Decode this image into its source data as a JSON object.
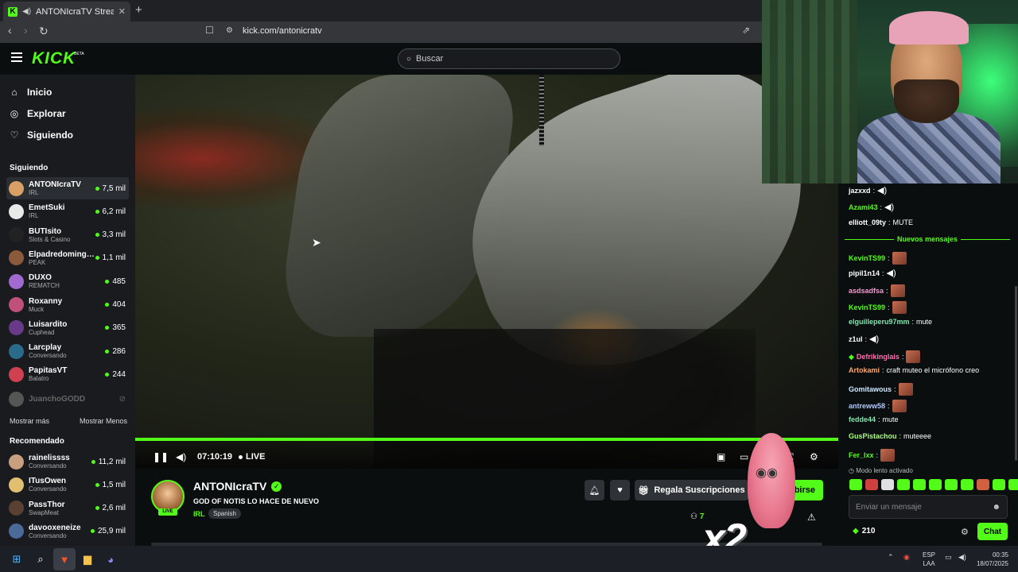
{
  "browser": {
    "tab_title": "ANTONIcraTV Stream - Watc",
    "tab_favicon": "K",
    "new_tab": "+",
    "url": "kick.com/antonicratv"
  },
  "header": {
    "logo": "KICK",
    "logo_badge": "BETA",
    "search_placeholder": "Buscar"
  },
  "nav": [
    {
      "label": "Inicio",
      "icon": "home-icon"
    },
    {
      "label": "Explorar",
      "icon": "compass-icon"
    },
    {
      "label": "Siguiendo",
      "icon": "heart-icon"
    }
  ],
  "sidebar": {
    "following_title": "Siguiendo",
    "following": [
      {
        "name": "ANTONIcraTV",
        "game": "IRL",
        "viewers": "7,5 mil",
        "color": "#d9a066"
      },
      {
        "name": "EmetSuki",
        "game": "IRL",
        "viewers": "6,2 mil",
        "color": "#e8e8e8"
      },
      {
        "name": "BUTIsito",
        "game": "Slots & Casino",
        "viewers": "3,3 mil",
        "color": "#222222"
      },
      {
        "name": "Elpadredomingo…",
        "game": "PEAK",
        "viewers": "1,1 mil",
        "color": "#8a5a3a"
      },
      {
        "name": "DUXO",
        "game": "REMATCH",
        "viewers": "485",
        "color": "#a06ad0"
      },
      {
        "name": "Roxanny",
        "game": "Muck",
        "viewers": "404",
        "color": "#c0507a"
      },
      {
        "name": "Luisardito",
        "game": "Cuphead",
        "viewers": "365",
        "color": "#6a3a8a"
      },
      {
        "name": "Larcplay",
        "game": "Conversando",
        "viewers": "286",
        "color": "#2a6a8a"
      },
      {
        "name": "PapitasVT",
        "game": "Balatro",
        "viewers": "244",
        "color": "#d04050"
      }
    ],
    "offline": {
      "name": "JuanchoGODD",
      "color": "#555555"
    },
    "show_more": "Mostrar más",
    "show_less": "Mostrar Menos",
    "recommended_title": "Recomendado",
    "recommended": [
      {
        "name": "rainelissss",
        "game": "Conversando",
        "viewers": "11,2 mil",
        "color": "#c8a080"
      },
      {
        "name": "ITusOwen",
        "game": "Conversando",
        "viewers": "1,5 mil",
        "color": "#e0c070"
      },
      {
        "name": "PassThor",
        "game": "SwapMeat",
        "viewers": "2,6 mil",
        "color": "#5a4030"
      },
      {
        "name": "davooxeneize",
        "game": "Conversando",
        "viewers": "25,9 mil",
        "color": "#4a6a9a"
      }
    ]
  },
  "player": {
    "time": "07:10:19",
    "live": "LIVE",
    "progress_pct": 100
  },
  "stream": {
    "channel": "ANTONIcraTV",
    "live_badge": "LIVE",
    "title": "GOD OF NOTIS LO HACE DE NUEVO",
    "category": "IRL",
    "tag": "Spanish",
    "gift_label": "Regala Suscripciones",
    "subscribe_label": "cribirse",
    "viewers_partial": "7"
  },
  "overlay": {
    "multiplier": "x2"
  },
  "chat": {
    "messages": [
      {
        "user": "jazxxd",
        "text": "",
        "kind": "speaker",
        "color": "#ffffff"
      },
      {
        "user": "Azami43",
        "text": "",
        "kind": "speaker",
        "color": "#53fc18"
      },
      {
        "user": "elliott_09ty",
        "text": "MUTE",
        "kind": "text",
        "color": "#ffffff"
      },
      {
        "user": "KevinTS99",
        "text": "",
        "kind": "emote",
        "color": "#53fc18"
      },
      {
        "user": "pipil1n14",
        "text": "",
        "kind": "speaker",
        "color": "#ffffff"
      },
      {
        "user": "asdsadfsa",
        "text": "",
        "kind": "emote",
        "color": "#f39ad2"
      },
      {
        "user": "KevinTS99",
        "text": "",
        "kind": "emote",
        "color": "#53fc18"
      },
      {
        "user": "elguilleperu97mm",
        "text": "mute",
        "kind": "text",
        "color": "#7ee8b0"
      },
      {
        "user": "z1ul",
        "text": "",
        "kind": "speaker",
        "color": "#ffffff"
      },
      {
        "user": "Defrikinglais",
        "text": "",
        "kind": "emote-badge",
        "color": "#ff6fb0"
      },
      {
        "user": "Artokami",
        "text": "craft muteo el micrófono creo",
        "kind": "text",
        "color": "#ffa76b"
      },
      {
        "user": "Gomitawous",
        "text": "",
        "kind": "emote",
        "color": "#cfe8ff"
      },
      {
        "user": "antreww58",
        "text": "",
        "kind": "emote",
        "color": "#b0c8ff"
      },
      {
        "user": "fedde44",
        "text": "mute",
        "kind": "text",
        "color": "#7ee8b0"
      },
      {
        "user": "GusPistachou",
        "text": "muteeee",
        "kind": "text",
        "color": "#a6ff7a"
      },
      {
        "user": "Fer_lxx",
        "text": "",
        "kind": "emote",
        "color": "#53fc18"
      }
    ],
    "new_messages": "Nuevos mensajes",
    "slow_mode": "Modo lento activado",
    "input_placeholder": "Enviar un mensaje",
    "points": "210",
    "chat_button": "Chat"
  },
  "taskbar": {
    "lang_top": "ESP",
    "lang_bottom": "LAA",
    "time": "00:35",
    "date": "18/07/2025"
  }
}
